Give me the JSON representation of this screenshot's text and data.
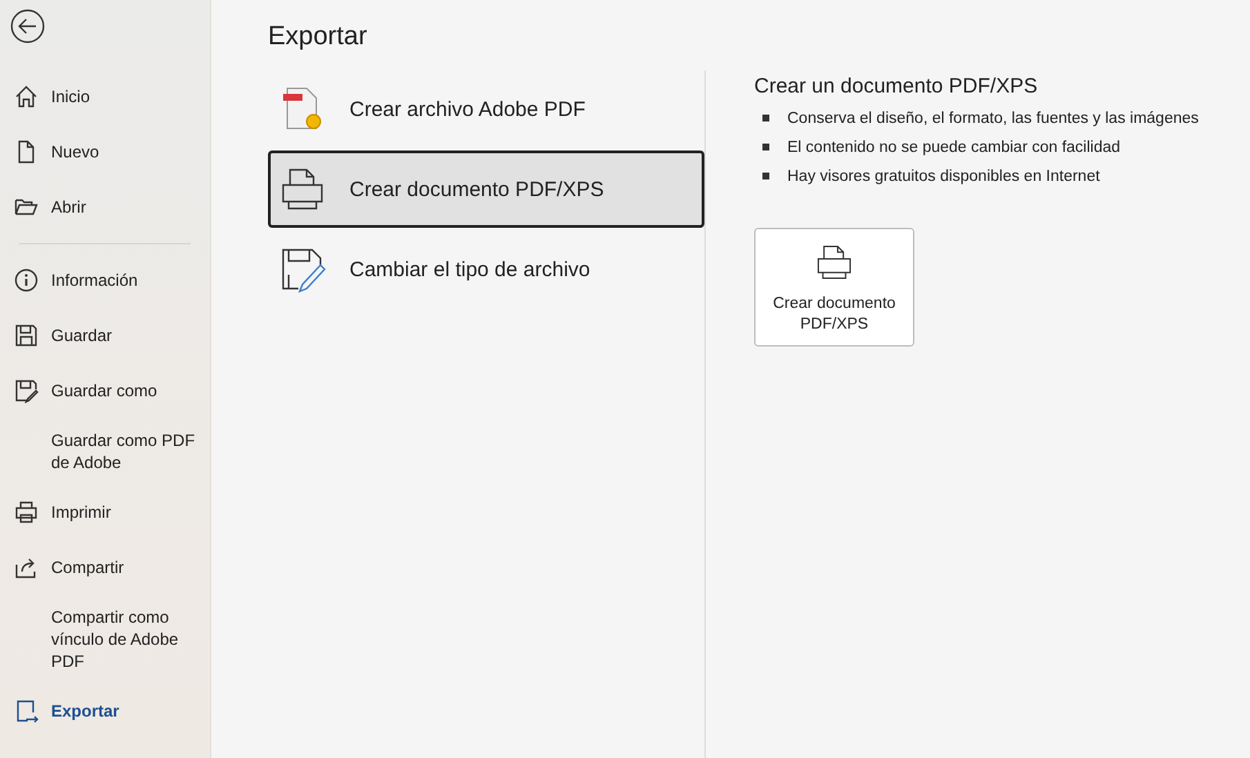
{
  "sidebar": {
    "sections": [
      [
        {
          "label": "Inicio",
          "kind": "home",
          "selected": false
        },
        {
          "label": "Nuevo",
          "kind": "new",
          "selected": false
        },
        {
          "label": "Abrir",
          "kind": "open",
          "selected": false
        }
      ],
      [
        {
          "label": "Información",
          "kind": "info",
          "selected": false
        },
        {
          "label": "Guardar",
          "kind": "save",
          "selected": false
        },
        {
          "label": "Guardar como",
          "kind": "saveas",
          "selected": false
        },
        {
          "label": "Guardar como PDF de Adobe",
          "kind": "text",
          "selected": false
        },
        {
          "label": "Imprimir",
          "kind": "print",
          "selected": false
        },
        {
          "label": "Compartir",
          "kind": "share",
          "selected": false
        },
        {
          "label": "Compartir como vínculo de Adobe PDF",
          "kind": "text",
          "selected": false
        },
        {
          "label": "Exportar",
          "kind": "export",
          "selected": true
        }
      ]
    ]
  },
  "title": "Exportar",
  "options": [
    {
      "label": "Crear archivo Adobe PDF",
      "kind": "adobe",
      "selected": false
    },
    {
      "label": "Crear documento PDF/XPS",
      "kind": "printer",
      "selected": true
    },
    {
      "label": "Cambiar el tipo de archivo",
      "kind": "changetype",
      "selected": false
    }
  ],
  "detail": {
    "heading": "Crear un documento PDF/XPS",
    "bullets": [
      "Conserva el diseño, el formato, las fuentes y las imágenes",
      "El contenido no se puede cambiar con facilidad",
      "Hay visores gratuitos disponibles en Internet"
    ],
    "button": "Crear documento PDF/XPS"
  }
}
